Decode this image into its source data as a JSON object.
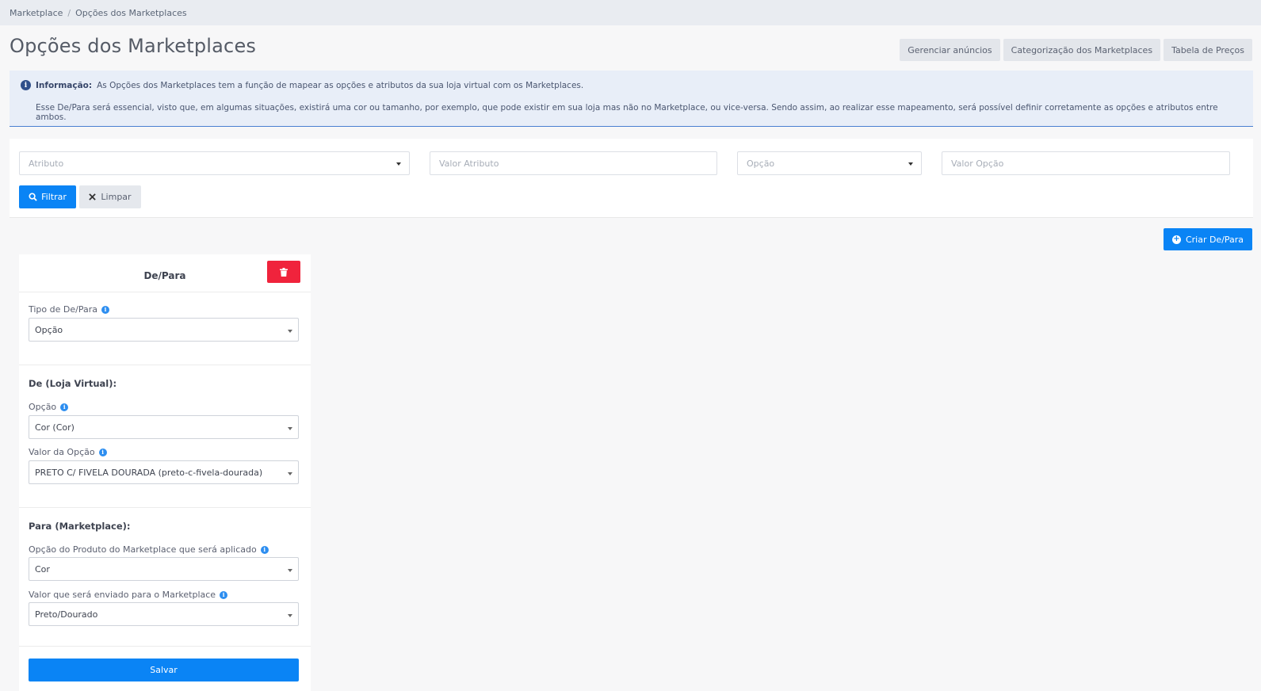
{
  "breadcrumb": {
    "items": [
      "Marketplace",
      "Opções dos Marketplaces"
    ],
    "separator": "/"
  },
  "page": {
    "title": "Opções dos Marketplaces"
  },
  "top_buttons": [
    "Gerenciar anúncios",
    "Categorização dos Marketplaces",
    "Tabela de Preços"
  ],
  "info": {
    "label": "Informação:",
    "text1": "As Opções dos Marketplaces tem a função de mapear as opções e atributos da sua loja virtual com os Marketplaces.",
    "text2": "Esse De/Para será essencial, visto que, em algumas situações, existirá uma cor ou tamanho, por exemplo, que pode existir em sua loja mas não no Marketplace, ou vice-versa. Sendo assim, ao realizar esse mapeamento, será possível definir corretamente as opções e atributos entre ambos."
  },
  "filters": {
    "atributo_placeholder": "Atributo",
    "valor_atributo_placeholder": "Valor Atributo",
    "opcao_placeholder": "Opção",
    "valor_opcao_placeholder": "Valor Opção",
    "filtrar_label": "Filtrar",
    "limpar_label": "Limpar"
  },
  "criar_label": "Criar De/Para",
  "card": {
    "title": "De/Para",
    "tipo_label": "Tipo de De/Para",
    "tipo_value": "Opção",
    "de_title": "De (Loja Virtual):",
    "opcao_label": "Opção",
    "opcao_value": "Cor (Cor)",
    "valor_opcao_label": "Valor da Opção",
    "valor_opcao_value": "PRETO C/ FIVELA DOURADA (preto-c-fivela-dourada)",
    "para_title": "Para (Marketplace):",
    "mp_opcao_label": "Opção do Produto do Marketplace que será aplicado",
    "mp_opcao_value": "Cor",
    "mp_valor_label": "Valor que será enviado para o Marketplace",
    "mp_valor_value": "Preto/Dourado",
    "salvar_label": "Salvar"
  },
  "colors": {
    "primary": "#0a84f5",
    "danger": "#f0233c",
    "info_bg": "#e8eef8"
  }
}
